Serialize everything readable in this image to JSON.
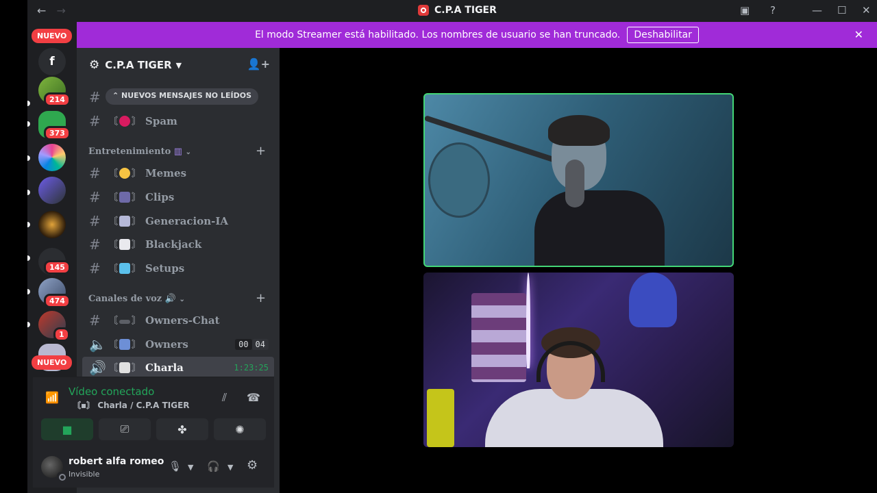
{
  "window": {
    "title": "C.P.A TIGER",
    "back": "←",
    "forward": "→"
  },
  "rail": {
    "new_top": "NUEVO",
    "new_bottom": "NUEVO",
    "badges": [
      "214",
      "373",
      "145",
      "474",
      "1"
    ]
  },
  "banner": {
    "text": "El modo Streamer está habilitado. Los nombres de usuario se han truncado.",
    "button": "Deshabilitar"
  },
  "guild": {
    "name": "C.P.A TIGER"
  },
  "unread_pill": "NUEVOS MENSAJES NO LEÍDOS",
  "channels": {
    "spam": "Spam",
    "memes": "Memes",
    "clips": "Clips",
    "generacion": "Generacion-IA",
    "blackjack": "Blackjack",
    "setups": "Setups",
    "owners_chat": "Owners-Chat",
    "owners": "Owners",
    "charla": "Charla"
  },
  "categories": {
    "entretenimiento": "Entretenimiento",
    "voz": "Canales de voz"
  },
  "owners_counts": [
    "00",
    "04"
  ],
  "charla_time": "1:23:25",
  "voice_panel": {
    "status": "Vídeo conectado",
    "location": "Charla / C.P.A TIGER"
  },
  "user": {
    "name": "robert alfa romeo",
    "status": "Invisible"
  },
  "colors": {
    "accent_green": "#23a55a",
    "banner_purple": "#a02bd8",
    "badge_red": "#f23f43"
  }
}
